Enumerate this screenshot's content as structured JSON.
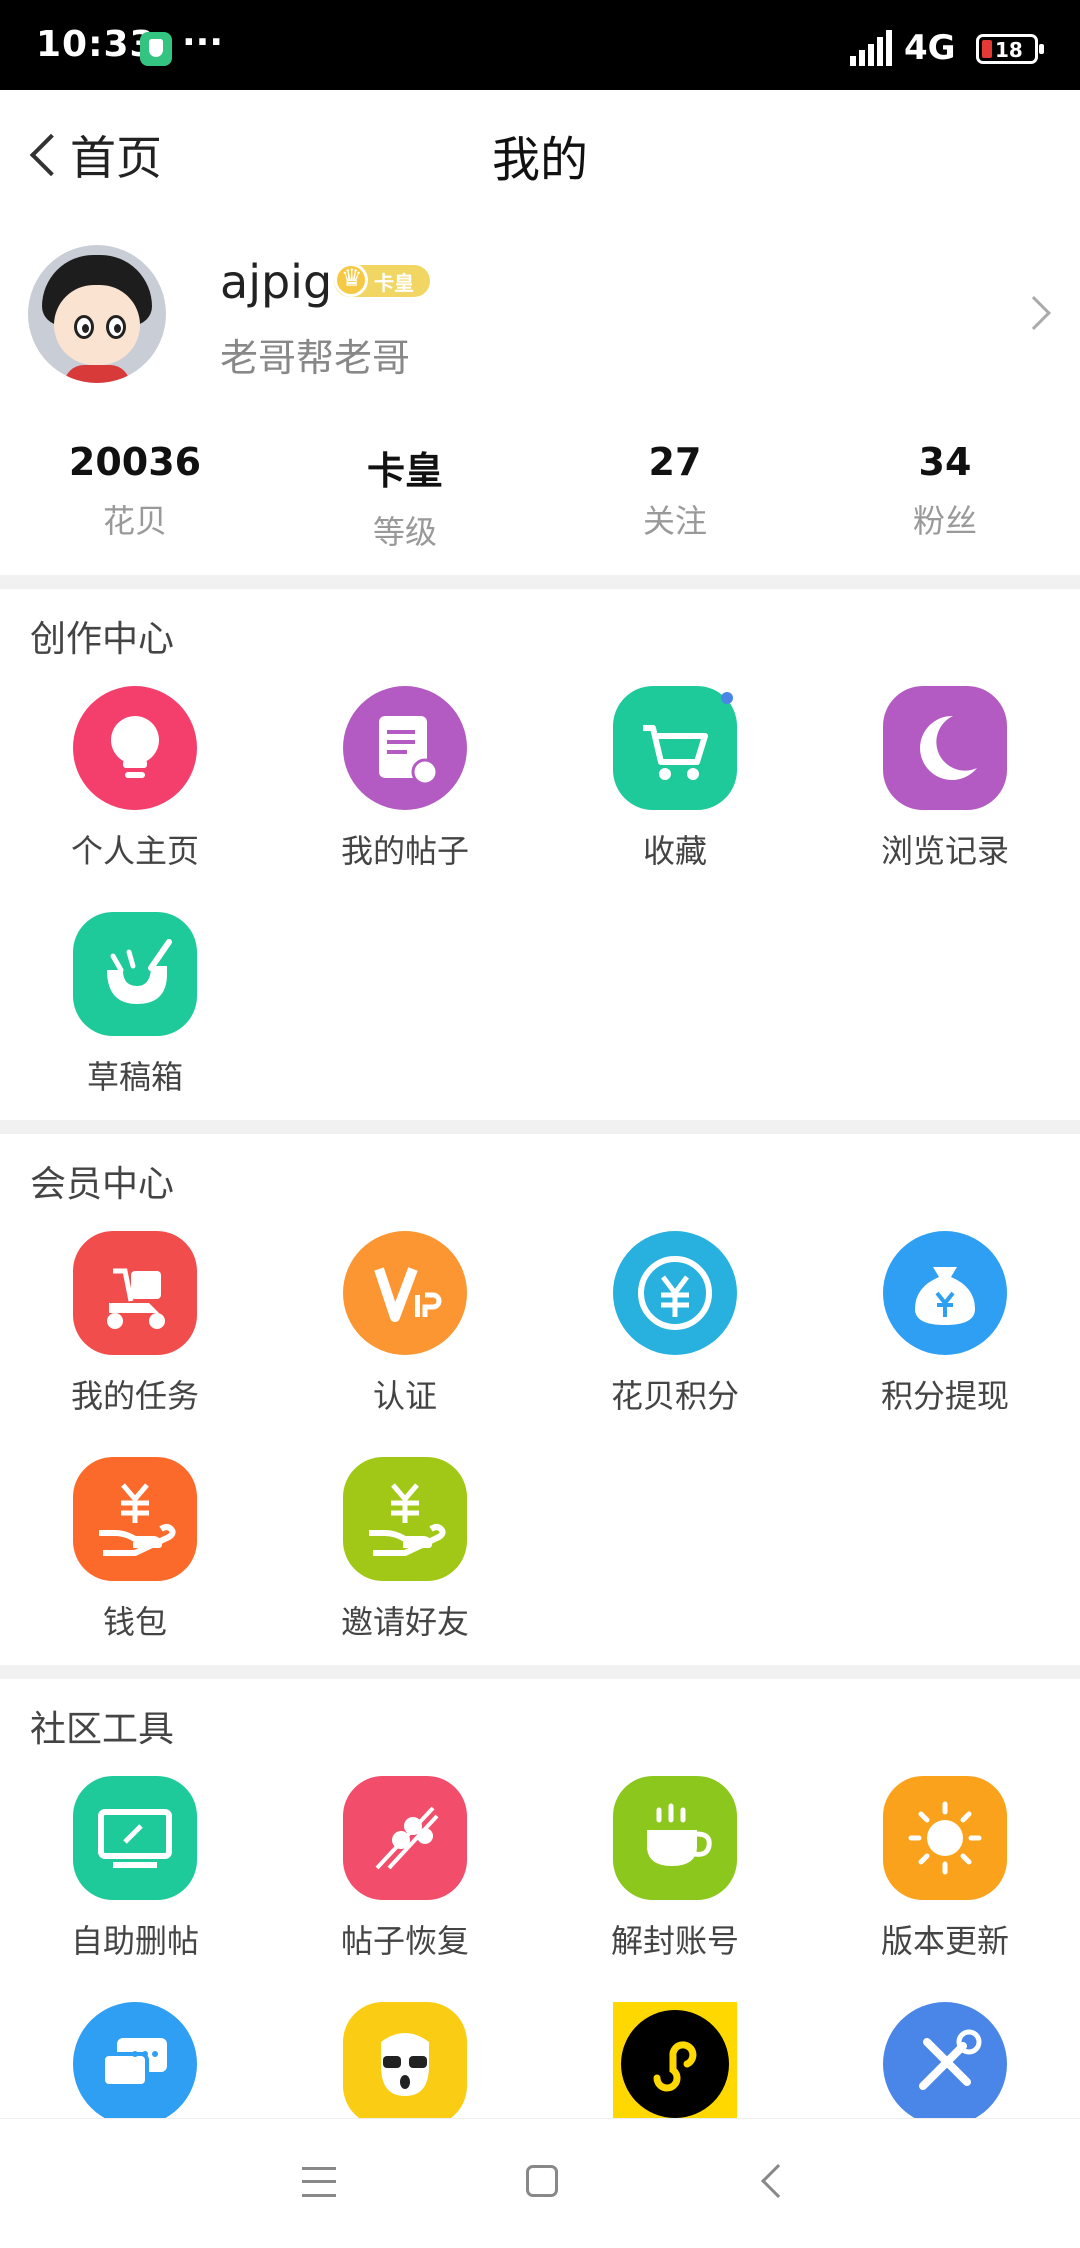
{
  "status_bar": {
    "time": "10:33",
    "dots": "···",
    "network": "4G",
    "battery_level": "18"
  },
  "header": {
    "back_label": "首页",
    "title": "我的"
  },
  "profile": {
    "username": "ajpig",
    "badge": "卡皇",
    "signature": "老哥帮老哥"
  },
  "stats": [
    {
      "value": "20036",
      "label": "花贝"
    },
    {
      "value": "卡皇",
      "label": "等级"
    },
    {
      "value": "27",
      "label": "关注"
    },
    {
      "value": "34",
      "label": "粉丝"
    }
  ],
  "sections": [
    {
      "title": "创作中心",
      "items": [
        {
          "label": "个人主页",
          "icon": "lightbulb-icon",
          "color": "#f43f6c"
        },
        {
          "label": "我的帖子",
          "icon": "document-icon",
          "color": "#b35bc2"
        },
        {
          "label": "收藏",
          "icon": "cart-icon",
          "color": "#1ec99a"
        },
        {
          "label": "浏览记录",
          "icon": "moon-icon",
          "color": "#b35bc2"
        },
        {
          "label": "草稿箱",
          "icon": "drafts-icon",
          "color": "#1ec99a"
        }
      ]
    },
    {
      "title": "会员中心",
      "items": [
        {
          "label": "我的任务",
          "icon": "scooter-icon",
          "color": "#f24d4d"
        },
        {
          "label": "认证",
          "icon": "vip-icon",
          "color": "#fb9632"
        },
        {
          "label": "花贝积分",
          "icon": "yuan-exchange-icon",
          "color": "#28b1de"
        },
        {
          "label": "积分提现",
          "icon": "money-bag-icon",
          "color": "#2e9ff2"
        },
        {
          "label": "钱包",
          "icon": "yuan-hand-icon",
          "color": "#fb6a2a"
        },
        {
          "label": "邀请好友",
          "icon": "yuan-hand-icon",
          "color": "#a2c817"
        }
      ]
    },
    {
      "title": "社区工具",
      "items": [
        {
          "label": "自助删帖",
          "icon": "monitor-icon",
          "color": "#1ec99a"
        },
        {
          "label": "帖子恢复",
          "icon": "skewer-icon",
          "color": "#f24d6a"
        },
        {
          "label": "解封账号",
          "icon": "cup-icon",
          "color": "#8cc71d"
        },
        {
          "label": "版本更新",
          "icon": "sun-icon",
          "color": "#fba21c"
        },
        {
          "label": "",
          "icon": "chat-icon",
          "color": "#2e9ff2"
        },
        {
          "label": "",
          "icon": "face-icon",
          "color": "#fbcc14"
        },
        {
          "label": "",
          "icon": "miniprogram-icon",
          "color": "#ffd800"
        },
        {
          "label": "",
          "icon": "tools-icon",
          "color": "#4a86e8"
        }
      ]
    }
  ]
}
